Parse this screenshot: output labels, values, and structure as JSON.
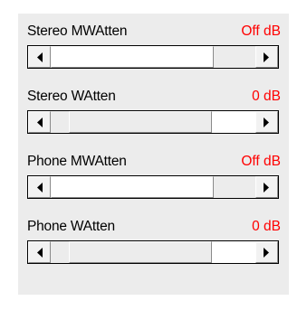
{
  "controls": [
    {
      "label": "Stereo MWAtten",
      "value": "Off dB",
      "level": 0.0
    },
    {
      "label": "Stereo WAtten",
      "value": "0 dB",
      "level": 0.3
    },
    {
      "label": "Phone MWAtten",
      "value": "Off dB",
      "level": 0.0
    },
    {
      "label": "Phone WAtten",
      "value": "0 dB",
      "level": 0.3
    }
  ],
  "colors": {
    "value_text": "#ff0000",
    "panel_bg": "#ececec"
  },
  "icons": {
    "left": "left-arrow-icon",
    "right": "right-arrow-icon"
  }
}
